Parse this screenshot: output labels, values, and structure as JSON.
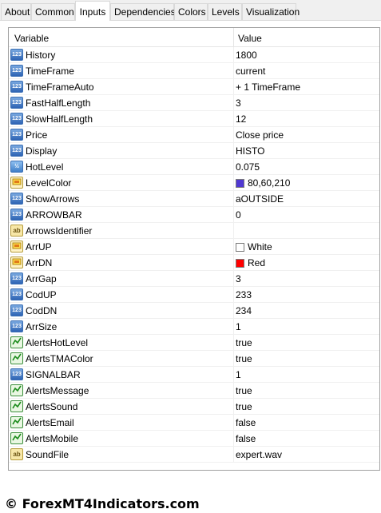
{
  "tabs": [
    {
      "label": "About"
    },
    {
      "label": "Common"
    },
    {
      "label": "Inputs",
      "active": true
    },
    {
      "label": "Dependencies"
    },
    {
      "label": "Colors"
    },
    {
      "label": "Levels"
    },
    {
      "label": "Visualization"
    }
  ],
  "grid": {
    "header_variable": "Variable",
    "header_value": "Value",
    "rows": [
      {
        "name": "History",
        "value": "1800",
        "icon": "num"
      },
      {
        "name": "TimeFrame",
        "value": "current",
        "icon": "num"
      },
      {
        "name": "TimeFrameAuto",
        "value": "+ 1 TimeFrame",
        "icon": "num"
      },
      {
        "name": "FastHalfLength",
        "value": "3",
        "icon": "num"
      },
      {
        "name": "SlowHalfLength",
        "value": "12",
        "icon": "num"
      },
      {
        "name": "Price",
        "value": "Close price",
        "icon": "num"
      },
      {
        "name": "Display",
        "value": "HISTO",
        "icon": "num"
      },
      {
        "name": "HotLevel",
        "value": "0.075",
        "icon": "frac"
      },
      {
        "name": "LevelColor",
        "value": "80,60,210",
        "icon": "color",
        "swatch": "#5038d2"
      },
      {
        "name": "ShowArrows",
        "value": "aOUTSIDE",
        "icon": "num"
      },
      {
        "name": "ARROWBAR",
        "value": "0",
        "icon": "num"
      },
      {
        "name": "ArrowsIdentifier",
        "value": "",
        "icon": "str"
      },
      {
        "name": "ArrUP",
        "value": "White",
        "icon": "color",
        "swatch": "#ffffff"
      },
      {
        "name": "ArrDN",
        "value": "Red",
        "icon": "color",
        "swatch": "#ff0000"
      },
      {
        "name": "ArrGap",
        "value": "3",
        "icon": "num"
      },
      {
        "name": "CodUP",
        "value": "233",
        "icon": "num"
      },
      {
        "name": "CodDN",
        "value": "234",
        "icon": "num"
      },
      {
        "name": "ArrSize",
        "value": "1",
        "icon": "num"
      },
      {
        "name": "AlertsHotLevel",
        "value": "true",
        "icon": "bool"
      },
      {
        "name": "AlertsTMAColor",
        "value": "true",
        "icon": "bool"
      },
      {
        "name": "SIGNALBAR",
        "value": "1",
        "icon": "num"
      },
      {
        "name": "AlertsMessage",
        "value": "true",
        "icon": "bool"
      },
      {
        "name": "AlertsSound",
        "value": "true",
        "icon": "bool"
      },
      {
        "name": "AlertsEmail",
        "value": "false",
        "icon": "bool"
      },
      {
        "name": "AlertsMobile",
        "value": "false",
        "icon": "bool"
      },
      {
        "name": "SoundFile",
        "value": "expert.wav",
        "icon": "str"
      }
    ]
  },
  "icon_labels": {
    "num": "123",
    "frac": "½",
    "str": "ab",
    "color": "",
    "bool": ""
  },
  "watermark": "© ForexMT4Indicators.com"
}
